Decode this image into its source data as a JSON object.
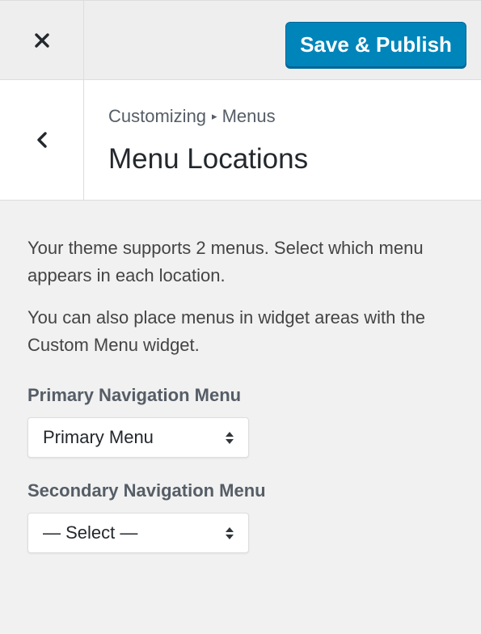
{
  "topbar": {
    "close_icon": "close-icon",
    "save_label": "Save & Publish",
    "accent_color": "#0085ba"
  },
  "section": {
    "back_icon": "chevron-left-icon",
    "breadcrumb_parent": "Customizing",
    "breadcrumb_current": "Menus",
    "breadcrumb_separator": "▸",
    "title": "Menu Locations"
  },
  "content": {
    "description_1": "Your theme supports 2 menus. Select which menu appears in each location.",
    "description_2": "You can also place menus in widget areas with the Custom Menu widget.",
    "locations": [
      {
        "label": "Primary Navigation Menu",
        "selected": "Primary Menu"
      },
      {
        "label": "Secondary Navigation Menu",
        "selected": "— Select —"
      }
    ]
  }
}
